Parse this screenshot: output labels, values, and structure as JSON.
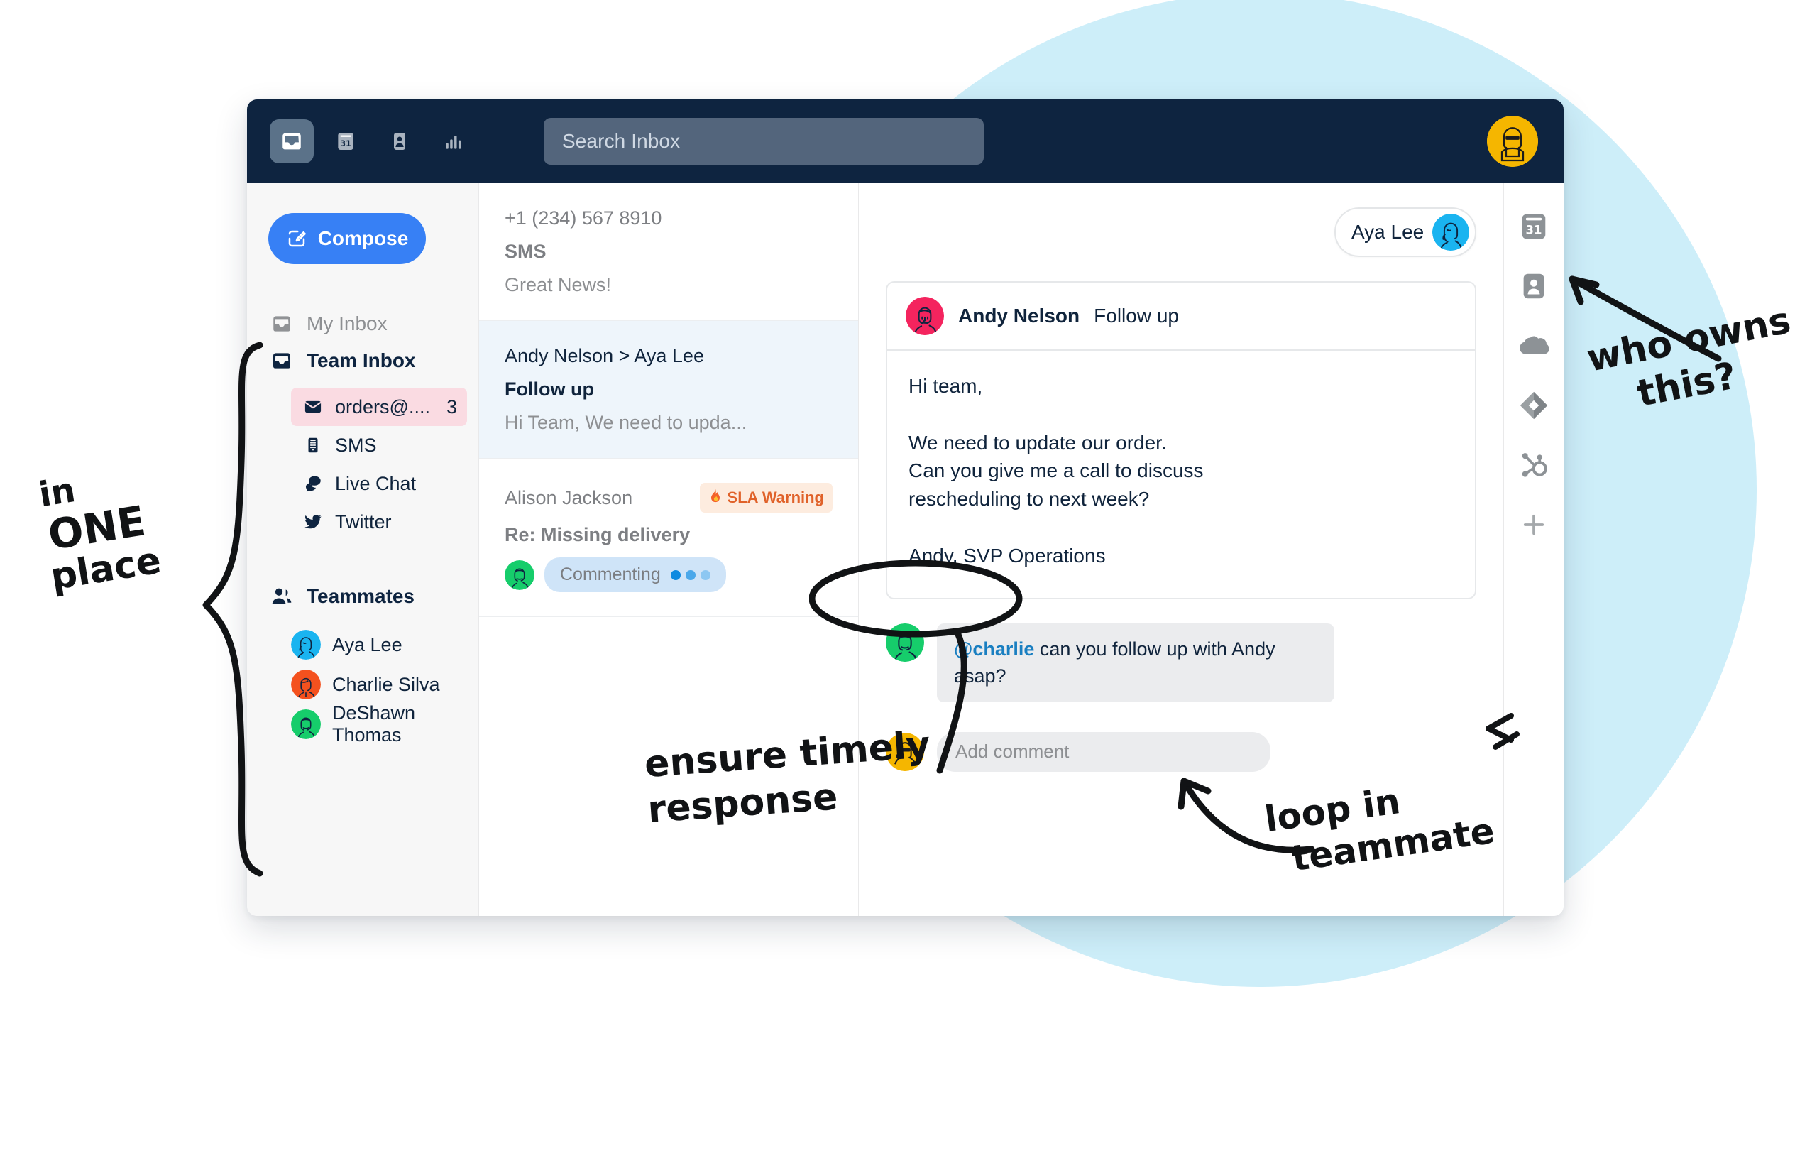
{
  "app": {
    "topbar": {
      "nav_icons": [
        {
          "name": "inbox-icon",
          "label": "Inbox",
          "active": true
        },
        {
          "name": "calendar-icon",
          "label": "Calendar",
          "active": false
        },
        {
          "name": "contacts-icon",
          "label": "Contacts",
          "active": false
        },
        {
          "name": "reports-icon",
          "label": "Reports",
          "active": false
        }
      ],
      "search_placeholder": "Search Inbox",
      "avatar_name": "user-avatar",
      "avatar_color": "#f5b600",
      "background_color": "#0e2440"
    },
    "sidebar": {
      "compose_label": "Compose",
      "compose_color": "#3780f5",
      "nav": [
        {
          "label": "My Inbox",
          "icon": "inbox-outline-icon",
          "style": "muted"
        },
        {
          "label": "Team Inbox",
          "icon": "inbox-filled-icon",
          "style": "strong"
        }
      ],
      "channels": [
        {
          "label": "orders@....",
          "icon": "envelope-icon",
          "count": "3",
          "selected": true,
          "highlight": "#fadbe2"
        },
        {
          "label": "SMS",
          "icon": "phone-keypad-icon",
          "count": "",
          "selected": false
        },
        {
          "label": "Live Chat",
          "icon": "chat-bubbles-icon",
          "count": "",
          "selected": false
        },
        {
          "label": "Twitter",
          "icon": "twitter-bird-icon",
          "count": "",
          "selected": false
        }
      ],
      "teammates_label": "Teammates",
      "teammates_icon": "people-icon",
      "teammates": [
        {
          "name": "Aya Lee",
          "avatar_color": "#1ab4f0"
        },
        {
          "name": "Charlie Silva",
          "avatar_color": "#f4511e"
        },
        {
          "name": "DeShawn Thomas",
          "avatar_color": "#16cd6b"
        }
      ]
    },
    "conversation_list": [
      {
        "from": "+1 (234) 567 8910",
        "subject": "SMS",
        "preview": "Great News!",
        "selected": false,
        "badge": null,
        "commenting": null
      },
      {
        "from": "Andy Nelson > Aya Lee",
        "subject": "Follow up",
        "preview": "Hi Team, We need to upda...",
        "selected": true,
        "badge": null,
        "commenting": null
      },
      {
        "from": "Alison Jackson",
        "subject": "Re: Missing delivery",
        "preview": "",
        "selected": false,
        "badge": {
          "label": "SLA Warning",
          "icon": "flame-icon",
          "color": "#e0622a",
          "bg": "#fdecdf"
        },
        "commenting": {
          "label": "Commenting",
          "avatar_color": "#16cd6b",
          "dot_colors": [
            "#0e8ae0",
            "#4ba8ea",
            "#8cc7f2"
          ]
        }
      }
    ],
    "thread": {
      "assignee": {
        "label": "Aya Lee",
        "avatar_color": "#1ab4f0"
      },
      "message": {
        "sender": "Andy Nelson",
        "sender_avatar_color": "#f4245e",
        "subject": "Follow up",
        "body": "Hi team,\n\nWe need to update our order.\nCan you give me a call to discuss\nrescheduling to next week?\n\nAndy, SVP Operations"
      },
      "comment": {
        "avatar_color": "#16cd6b",
        "mention": "@charlie",
        "text": " can you follow up with Andy asap?"
      },
      "add_comment": {
        "placeholder": "Add comment",
        "avatar_color": "#f5b600"
      }
    },
    "right_rail": [
      {
        "name": "calendar-31-icon",
        "label": "Calendar"
      },
      {
        "name": "contact-card-icon",
        "label": "Contact"
      },
      {
        "name": "salesforce-cloud-icon",
        "label": "Salesforce"
      },
      {
        "name": "diamond-icon",
        "label": "Integration"
      },
      {
        "name": "hubspot-sprocket-icon",
        "label": "HubSpot"
      },
      {
        "name": "plus-icon",
        "label": "Add app"
      }
    ]
  },
  "annotations": {
    "in_one_place": {
      "line1": "in",
      "line2": "ONE",
      "line3": "place"
    },
    "who_owns_this": {
      "line1": "who owns",
      "line2": "this?"
    },
    "ensure_timely_response": {
      "line1": "ensure timely",
      "line2": "response"
    },
    "loop_in_teammate": {
      "line1": "loop in",
      "line2": "teammate"
    }
  },
  "theme": {
    "navy": "#0e2440",
    "blue": "#3780f5",
    "circle_blue": "#cdeef9",
    "selected_row": "#eef5fb",
    "pink_highlight": "#fadbe2"
  }
}
